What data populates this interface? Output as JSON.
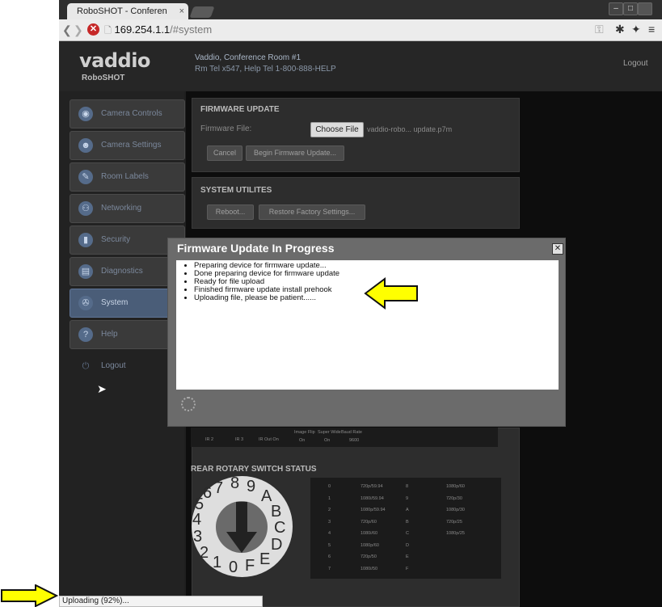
{
  "browser": {
    "tab_title": "RoboSHOT - Conferen",
    "tab_close": "×",
    "url_host": "169.254.1.1",
    "url_path": "/#system",
    "status_text": "Uploading (92%)..."
  },
  "header": {
    "logo": "vaddio",
    "sublogo": "RoboSHOT",
    "room": "Vaddio, Conference Room #1",
    "help": "Rm Tel x547, Help Tel 1-800-888-HELP",
    "logout": "Logout"
  },
  "sidebar": {
    "items": [
      {
        "label": "Camera Controls"
      },
      {
        "label": "Camera Settings"
      },
      {
        "label": "Room Labels"
      },
      {
        "label": "Networking"
      },
      {
        "label": "Security"
      },
      {
        "label": "Diagnostics"
      },
      {
        "label": "System"
      },
      {
        "label": "Help"
      },
      {
        "label": "Logout"
      }
    ],
    "active": "System"
  },
  "firmware": {
    "title": "FIRMWARE UPDATE",
    "file_label": "Firmware File:",
    "choose_label": "Choose File",
    "file_name": "vaddio-robo... update.p7m",
    "cancel_label": "Cancel",
    "begin_label": "Begin Firmware Update..."
  },
  "utilities": {
    "title": "SYSTEM UTILITES",
    "reboot_label": "Reboot...",
    "restore_label": "Restore Factory Settings..."
  },
  "modal": {
    "title": "Firmware Update In Progress",
    "close": "✕",
    "messages": [
      "Preparing device for firmware update...",
      "Done preparing device for firmware update",
      "Ready for file upload",
      "Finished firmware update install prehook",
      "Uploading file, please be patient......"
    ]
  },
  "dip": {
    "labels": [
      "IR 2",
      "IR 3",
      "IR Out On",
      "Image Flip",
      "Super Wide",
      "Baud Rate"
    ],
    "values": [
      "On",
      "On",
      "9600"
    ]
  },
  "rotary": {
    "title": "REAR ROTARY SWITCH STATUS",
    "dial_digits": [
      "7",
      "8",
      "9",
      "A",
      "B",
      "C",
      "D",
      "E",
      "F",
      "0",
      "1",
      "2",
      "3",
      "4",
      "5",
      "6"
    ],
    "table": [
      [
        "0",
        "720p/59.94",
        "8",
        "1080p/60"
      ],
      [
        "1",
        "1080i/59.94",
        "9",
        "720p/30"
      ],
      [
        "2",
        "1080p/59.94",
        "A",
        "1080p/30"
      ],
      [
        "3",
        "720p/60",
        "B",
        "720p/25"
      ],
      [
        "4",
        "1080i/60",
        "C",
        "1080p/25"
      ],
      [
        "5",
        "1080p/60",
        "D",
        ""
      ],
      [
        "6",
        "720p/50",
        "E",
        ""
      ],
      [
        "7",
        "1080i/50",
        "F",
        ""
      ]
    ]
  },
  "colors": {
    "annotation_arrow": "#ffff00",
    "active_nav": "#4a5d78"
  }
}
